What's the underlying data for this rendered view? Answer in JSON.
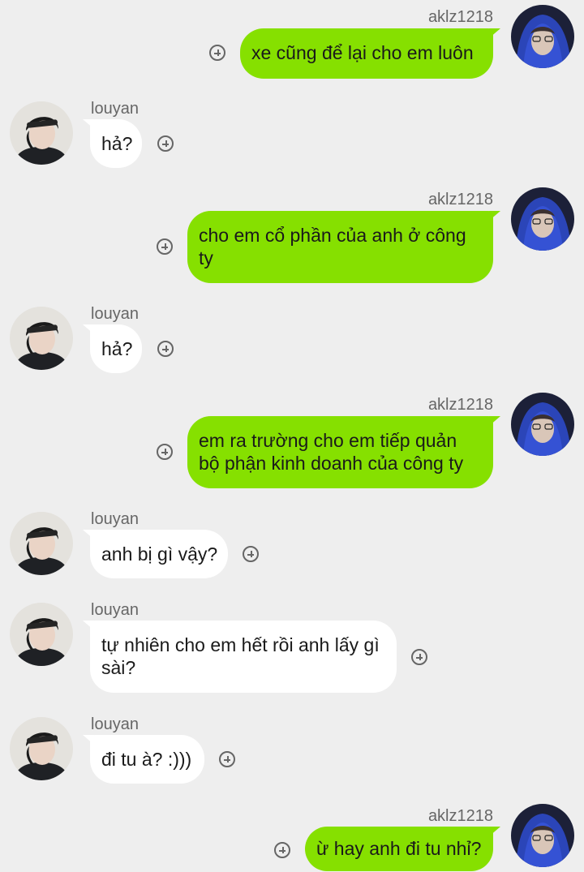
{
  "contacts": {
    "self_name": "aklz1218",
    "other_name": "louyan"
  },
  "messages": [
    {
      "sender": "aklz1218",
      "text": "xe cũng để lại cho em luôn"
    },
    {
      "sender": "louyan",
      "text": "hả?"
    },
    {
      "sender": "aklz1218",
      "text": "cho em cổ phần của anh ở công ty"
    },
    {
      "sender": "louyan",
      "text": "hả?"
    },
    {
      "sender": "aklz1218",
      "text": "em ra trường cho em tiếp quản bộ phận kinh doanh của công ty"
    },
    {
      "sender": "louyan",
      "text": "anh bị gì vậy?"
    },
    {
      "sender": "louyan",
      "text": "tự nhiên cho em hết rồi anh lấy gì sài?"
    },
    {
      "sender": "louyan",
      "text": "đi tu à? :)))"
    },
    {
      "sender": "aklz1218",
      "text": "ừ hay anh đi tu nhỉ?"
    }
  ],
  "icons": {
    "add_reaction": "plus-circle-icon",
    "self_avatar": "hooded-person-avatar",
    "other_avatar": "headband-person-avatar"
  },
  "colors": {
    "background": "#eeeeee",
    "outgoing_bubble": "#86e000",
    "incoming_bubble": "#ffffff",
    "name_text": "#666666"
  }
}
